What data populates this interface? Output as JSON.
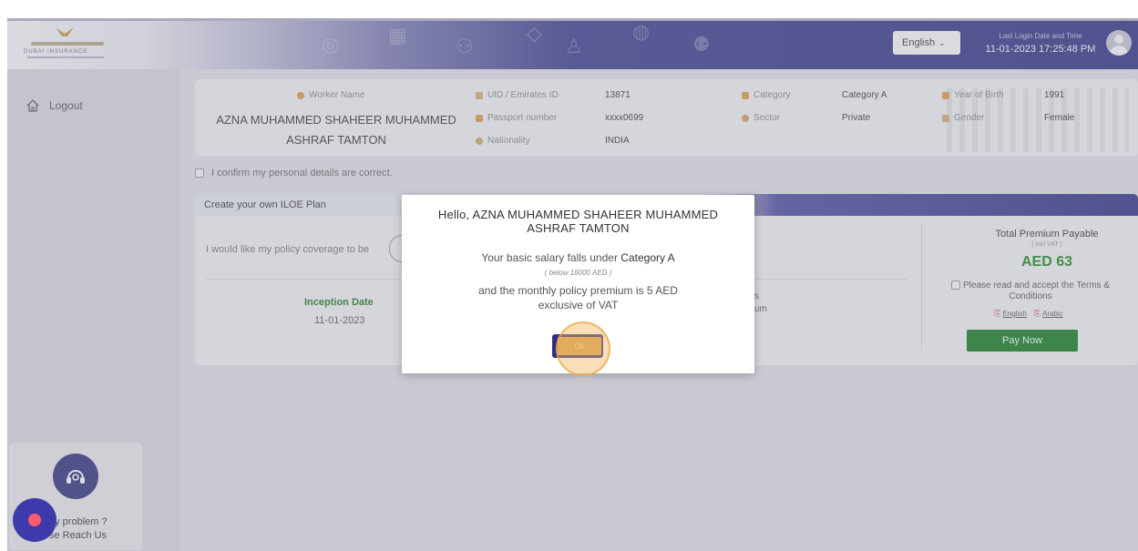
{
  "header": {
    "language": "English",
    "last_login_label": "Last Login Date and Time",
    "last_login_value": "11-01-2023 17:25:48 PM",
    "logo_text": "DUBAI INSURANCE"
  },
  "sidebar": {
    "logout_label": "Logout",
    "help_line1": "ny problem ?",
    "help_line2": "se Reach Us"
  },
  "worker": {
    "name_label": "Worker Name",
    "name_value": "AZNA MUHAMMED SHAHEER MUHAMMED ASHRAF TAMTON",
    "uid_label": "UID / Emirates ID",
    "uid_value": "13871",
    "passport_label": "Passport number",
    "passport_value": "xxxx0699",
    "nationality_label": "Nationality",
    "nationality_value": "INDIA",
    "category_label": "Category",
    "category_value": "Category A",
    "sector_label": "Sector",
    "sector_value": "Private",
    "yob_label": "Year of Birth",
    "yob_value": "1991",
    "gender_label": "Gender",
    "gender_value": "Female"
  },
  "confirm_text": "I confirm my personal details are correct.",
  "plan": {
    "title": "Create your own ILOE Plan",
    "coverage_text": "I would like my policy coverage to be",
    "inception_label": "Inception Date",
    "inception_value": "11-01-2023",
    "frag1": "s",
    "frag2": "um",
    "premium_title": "Total Premium Payable",
    "premium_sub": "( incl VAT )",
    "premium_amount": "AED 63",
    "terms_text": "Please read and accept the Terms & Conditions",
    "link_english": "English",
    "link_arabic": "Arabic",
    "pay_label": "Pay Now"
  },
  "modal": {
    "title": "Hello, AZNA MUHAMMED SHAHEER MUHAMMED ASHRAF TAMTON",
    "line1_prefix": "Your basic salary falls under",
    "line1_category": "Category A",
    "note": "( below 16000 AED )",
    "line2": "and the monthly policy premium is 5 AED",
    "line3": "exclusive of VAT",
    "ok_label": "Ok"
  },
  "colors": {
    "brand_navy": "#2e2f83",
    "pay_green": "#0e7d1a",
    "premium_green": "#1a8a1a",
    "inception_green": "#1c7a1c"
  }
}
